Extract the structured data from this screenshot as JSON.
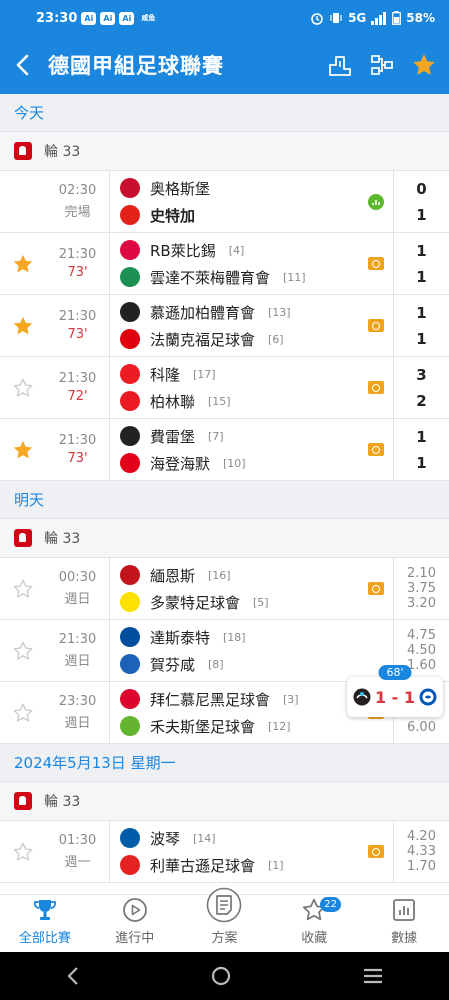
{
  "status": {
    "time": "23:30",
    "badges": [
      "Ai",
      "Ai",
      "Ai"
    ],
    "mini": "咸鱼",
    "network": "5G",
    "battery": "58%"
  },
  "header": {
    "title": "德國甲組足球聯賽",
    "icons": [
      "back-icon",
      "standings-icon",
      "bracket-icon",
      "star-icon"
    ]
  },
  "sections": [
    {
      "label": "今天",
      "round": "輪 33",
      "matches": [
        {
          "time": "02:30",
          "status": "完場",
          "live": false,
          "fav": false,
          "no_star": true,
          "home": {
            "name": "奥格斯堡",
            "rank": "",
            "bold": false,
            "color": "#c8102e"
          },
          "away": {
            "name": "史特加",
            "rank": "",
            "bold": true,
            "color": "#e32219"
          },
          "home_score": "0",
          "away_score": "1",
          "icon": "stats"
        },
        {
          "time": "21:30",
          "status": "73'",
          "live": true,
          "fav": true,
          "home": {
            "name": "RB萊比錫",
            "rank": "[4]",
            "bold": false,
            "color": "#dd0741"
          },
          "away": {
            "name": "雲達不萊梅體育會",
            "rank": "[11]",
            "bold": false,
            "color": "#1d9053"
          },
          "home_score": "1",
          "away_score": "1",
          "icon": "live"
        },
        {
          "time": "21:30",
          "status": "73'",
          "live": true,
          "fav": true,
          "home": {
            "name": "慕遜加柏體育會",
            "rank": "[13]",
            "bold": false,
            "color": "#222222"
          },
          "away": {
            "name": "法蘭克福足球會",
            "rank": "[6]",
            "bold": false,
            "color": "#e1000f"
          },
          "home_score": "1",
          "away_score": "1",
          "icon": "live"
        },
        {
          "time": "21:30",
          "status": "72'",
          "live": true,
          "fav": false,
          "home": {
            "name": "科隆",
            "rank": "[17]",
            "bold": false,
            "color": "#ed1c24"
          },
          "away": {
            "name": "柏林聯",
            "rank": "[15]",
            "bold": false,
            "color": "#eb1923"
          },
          "home_score": "3",
          "away_score": "2",
          "icon": "live"
        },
        {
          "time": "21:30",
          "status": "73'",
          "live": true,
          "fav": true,
          "home": {
            "name": "費雷堡",
            "rank": "[7]",
            "bold": false,
            "color": "#222222"
          },
          "away": {
            "name": "海登海默",
            "rank": "[10]",
            "bold": false,
            "color": "#e2001a"
          },
          "home_score": "1",
          "away_score": "1",
          "icon": "live"
        }
      ]
    },
    {
      "label": "明天",
      "round": "輪 33",
      "matches": [
        {
          "time": "00:30",
          "status": "週日",
          "live": false,
          "fav": false,
          "home": {
            "name": "緬恩斯",
            "rank": "[16]",
            "bold": false,
            "color": "#c3141e"
          },
          "away": {
            "name": "多蒙特足球會",
            "rank": "[5]",
            "bold": false,
            "color": "#fde100"
          },
          "odds": [
            "2.10",
            "3.75",
            "3.20"
          ],
          "icon": "live"
        },
        {
          "time": "21:30",
          "status": "週日",
          "live": false,
          "fav": false,
          "home": {
            "name": "達斯泰特",
            "rank": "[18]",
            "bold": false,
            "color": "#004e9e"
          },
          "away": {
            "name": "賀芬咸",
            "rank": "[8]",
            "bold": false,
            "color": "#1c63b7"
          },
          "odds": [
            "4.75",
            "4.50",
            "1.60"
          ],
          "icon": "none"
        },
        {
          "time": "23:30",
          "status": "週日",
          "live": false,
          "fav": false,
          "home": {
            "name": "拜仁慕尼黑足球會",
            "rank": "[3]",
            "bold": false,
            "color": "#dc052d"
          },
          "away": {
            "name": "禾夫斯堡足球會",
            "rank": "[12]",
            "bold": false,
            "color": "#65b32e"
          },
          "odds": [
            "1.30",
            "5.75",
            "6.00"
          ],
          "icon": "live"
        }
      ]
    },
    {
      "label": "2024年5月13日 星期一",
      "round": "輪 33",
      "matches": [
        {
          "time": "01:30",
          "status": "週一",
          "live": false,
          "fav": false,
          "home": {
            "name": "波琴",
            "rank": "[14]",
            "bold": false,
            "color": "#005ca9"
          },
          "away": {
            "name": "利華古遜足球會",
            "rank": "[1]",
            "bold": false,
            "color": "#e32221"
          },
          "odds": [
            "4.20",
            "4.33",
            "1.70"
          ],
          "icon": "live"
        }
      ]
    }
  ],
  "float_card": {
    "minute": "68'",
    "score": "1 - 1"
  },
  "tabs": [
    {
      "label": "全部比賽",
      "icon": "trophy-icon",
      "active": true,
      "badge": ""
    },
    {
      "label": "進行中",
      "icon": "play-icon",
      "active": false,
      "badge": ""
    },
    {
      "label": "方案",
      "icon": "plan-icon",
      "active": false,
      "badge": ""
    },
    {
      "label": "收藏",
      "icon": "star-outline-icon",
      "active": false,
      "badge": "22"
    },
    {
      "label": "數據",
      "icon": "chart-icon",
      "active": false,
      "badge": ""
    }
  ],
  "colors": {
    "primary": "#1b86de",
    "live_red": "#d9363e",
    "star_gold": "#f5a623",
    "live_orange": "#f0a31c"
  }
}
